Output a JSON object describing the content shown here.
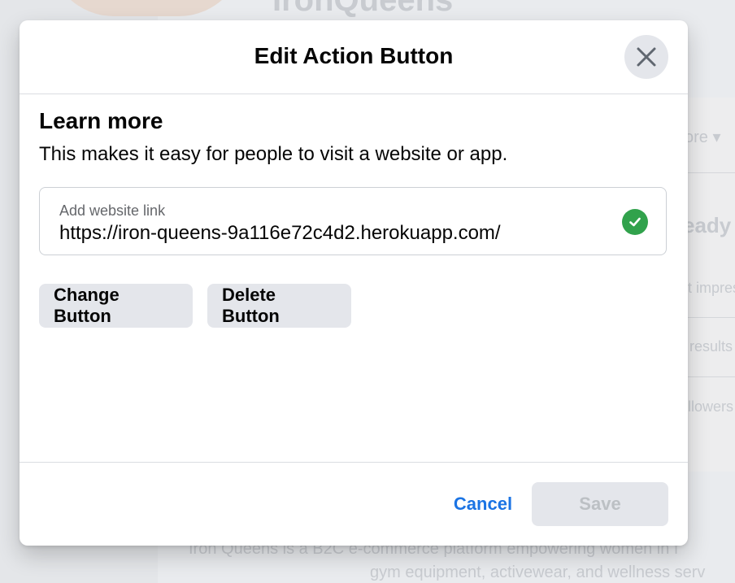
{
  "background": {
    "page_title": "IronQueens",
    "more_label": "ore",
    "ready_label": "eady",
    "impressions_label": "t impres",
    "results_label": "results",
    "followers_label": "llowers",
    "about_line1": "Iron Queens is a B2C e-commerce platform empowering women in f",
    "about_line2": "gym equipment, activewear, and wellness serv"
  },
  "modal": {
    "title": "Edit Action Button",
    "close_icon": "close-icon",
    "section_title": "Learn more",
    "section_description": "This makes it easy for people to visit a website or app.",
    "link_field": {
      "label": "Add website link",
      "value": "https://iron-queens-9a116e72c4d2.herokuapp.com/",
      "status_icon": "check-circle-icon",
      "status_color": "#31a24c"
    },
    "change_button_label": "Change Button",
    "delete_button_label": "Delete Button",
    "cancel_label": "Cancel",
    "save_label": "Save",
    "accent_color": "#1b74e4"
  }
}
